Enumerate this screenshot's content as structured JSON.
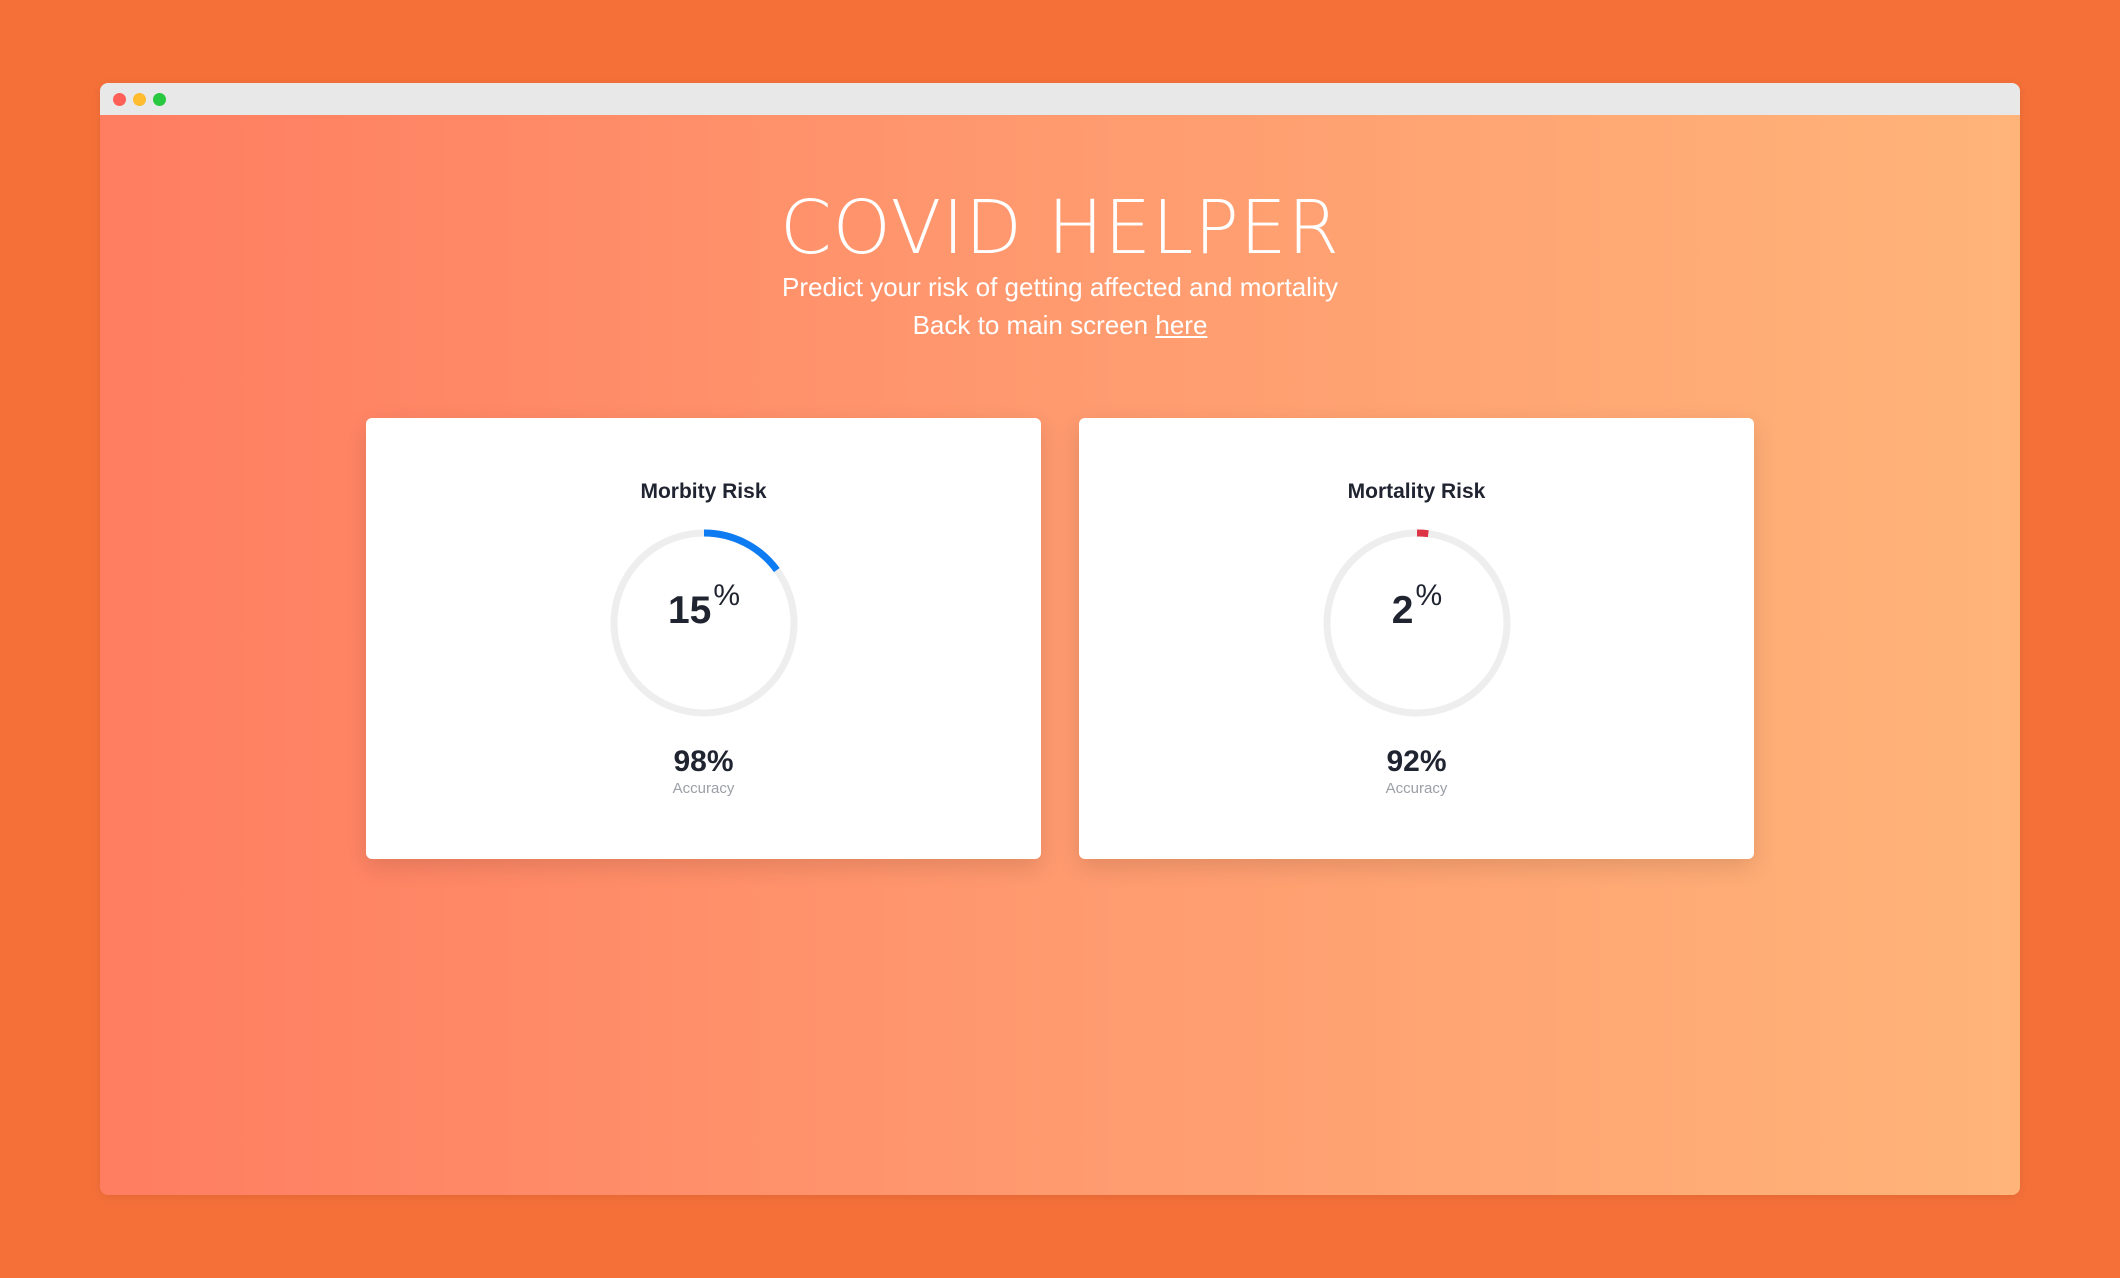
{
  "app": {
    "title": "COVID HELPER",
    "subtitle": "Predict your risk of getting affected and mortality",
    "back_prefix": "Back to main screen ",
    "back_link": "here"
  },
  "cards": [
    {
      "title": "Morbity Risk",
      "risk_value": "15",
      "risk_unit": "%",
      "risk_fraction": 0.15,
      "accent_color": "#0d7cf2",
      "accuracy_value": "98%",
      "accuracy_label": "Accuracy"
    },
    {
      "title": "Mortality Risk",
      "risk_value": "2",
      "risk_unit": "%",
      "risk_fraction": 0.02,
      "accent_color": "#dc3545",
      "accuracy_value": "92%",
      "accuracy_label": "Accuracy"
    }
  ],
  "colors": {
    "outer_bg": "#f57039",
    "gradient_left": "#ff7d61",
    "gradient_right": "#ffb479",
    "track": "#eeeeee",
    "text_dark": "#1f2430"
  }
}
